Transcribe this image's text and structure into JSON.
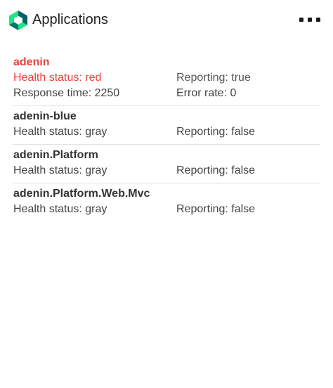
{
  "header": {
    "title": "Applications",
    "logo_icon": "new-relic-logo-icon",
    "menu_icon": "more-horizontal-icon"
  },
  "colors": {
    "accent_teal": "#1ce783",
    "logo_dark": "#0b5e66",
    "health_red": "#e8413c"
  },
  "applications": [
    {
      "name": "adenin",
      "health_status": "Health status: red",
      "reporting": "Reporting: true",
      "response_time": "Response time: 2250",
      "error_rate": "Error rate: 0"
    },
    {
      "name": "adenin-blue",
      "health_status": "Health status: gray",
      "reporting": "Reporting: false"
    },
    {
      "name": "adenin.Platform",
      "health_status": "Health status: gray",
      "reporting": "Reporting: false"
    },
    {
      "name": "adenin.Platform.Web.Mvc",
      "health_status": "Health status: gray",
      "reporting": "Reporting: false"
    }
  ]
}
